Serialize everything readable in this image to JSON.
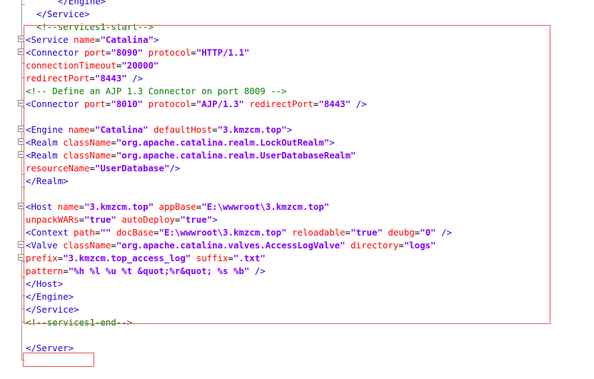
{
  "editor": {
    "lines": [
      {
        "indent": 6,
        "parts": [
          {
            "c": "tag",
            "t": "</Engine>"
          }
        ]
      },
      {
        "indent": 2,
        "parts": [
          {
            "c": "tag",
            "t": "</Service>"
          }
        ]
      },
      {
        "indent": 2,
        "parts": [
          {
            "c": "cmt",
            "t": "<!--services1-start-->"
          }
        ]
      },
      {
        "indent": 0,
        "parts": [
          {
            "c": "tag",
            "t": "<Service "
          },
          {
            "c": "attr",
            "t": "name"
          },
          {
            "c": "txt",
            "t": "="
          },
          {
            "c": "val",
            "t": "\"Catalina\""
          },
          {
            "c": "tag",
            "t": ">"
          }
        ]
      },
      {
        "indent": 0,
        "parts": [
          {
            "c": "tag",
            "t": "<Connector "
          },
          {
            "c": "attr",
            "t": "port"
          },
          {
            "c": "txt",
            "t": "="
          },
          {
            "c": "val",
            "t": "\"8090\""
          },
          {
            "c": "txt",
            "t": " "
          },
          {
            "c": "attr",
            "t": "protocol"
          },
          {
            "c": "txt",
            "t": "="
          },
          {
            "c": "val",
            "t": "\"HTTP/1.1\""
          }
        ]
      },
      {
        "indent": 0,
        "parts": [
          {
            "c": "attr",
            "t": "connectionTimeout"
          },
          {
            "c": "txt",
            "t": "="
          },
          {
            "c": "val",
            "t": "\"20000\""
          }
        ]
      },
      {
        "indent": 0,
        "parts": [
          {
            "c": "attr",
            "t": "redirectPort"
          },
          {
            "c": "txt",
            "t": "="
          },
          {
            "c": "val",
            "t": "\"8443\""
          },
          {
            "c": "txt",
            "t": " "
          },
          {
            "c": "tag",
            "t": "/>"
          }
        ]
      },
      {
        "indent": 0,
        "parts": [
          {
            "c": "cmt",
            "t": "<!-- Define an AJP 1.3 Connector on port 8009 -->"
          }
        ]
      },
      {
        "indent": 0,
        "parts": [
          {
            "c": "tag",
            "t": "<Connector "
          },
          {
            "c": "attr",
            "t": "port"
          },
          {
            "c": "txt",
            "t": "="
          },
          {
            "c": "val",
            "t": "\"8010\""
          },
          {
            "c": "txt",
            "t": " "
          },
          {
            "c": "attr",
            "t": "protocol"
          },
          {
            "c": "txt",
            "t": "="
          },
          {
            "c": "val",
            "t": "\"AJP/1.3\""
          },
          {
            "c": "txt",
            "t": " "
          },
          {
            "c": "attr",
            "t": "redirectPort"
          },
          {
            "c": "txt",
            "t": "="
          },
          {
            "c": "val",
            "t": "\"8443\""
          },
          {
            "c": "txt",
            "t": " "
          },
          {
            "c": "tag",
            "t": "/>"
          }
        ]
      },
      {
        "indent": 0,
        "parts": []
      },
      {
        "indent": 0,
        "parts": [
          {
            "c": "tag",
            "t": "<Engine "
          },
          {
            "c": "attr",
            "t": "name"
          },
          {
            "c": "txt",
            "t": "="
          },
          {
            "c": "val",
            "t": "\"Catalina\""
          },
          {
            "c": "txt",
            "t": " "
          },
          {
            "c": "attr",
            "t": "defaultHost"
          },
          {
            "c": "txt",
            "t": "="
          },
          {
            "c": "val",
            "t": "\"3.kmzcm.top\""
          },
          {
            "c": "tag",
            "t": ">"
          }
        ]
      },
      {
        "indent": 0,
        "parts": [
          {
            "c": "tag",
            "t": "<Realm "
          },
          {
            "c": "attr",
            "t": "className"
          },
          {
            "c": "txt",
            "t": "="
          },
          {
            "c": "val",
            "t": "\"org.apache.catalina.realm.LockOutRealm\""
          },
          {
            "c": "tag",
            "t": ">"
          }
        ]
      },
      {
        "indent": 0,
        "parts": [
          {
            "c": "tag",
            "t": "<Realm "
          },
          {
            "c": "attr",
            "t": "className"
          },
          {
            "c": "txt",
            "t": "="
          },
          {
            "c": "val",
            "t": "\"org.apache.catalina.realm.UserDatabaseRealm\""
          }
        ]
      },
      {
        "indent": 0,
        "parts": [
          {
            "c": "attr",
            "t": "resourceName"
          },
          {
            "c": "txt",
            "t": "="
          },
          {
            "c": "val",
            "t": "\"UserDatabase\""
          },
          {
            "c": "tag",
            "t": "/>"
          }
        ]
      },
      {
        "indent": 0,
        "parts": [
          {
            "c": "tag",
            "t": "</Realm>"
          }
        ]
      },
      {
        "indent": 0,
        "parts": []
      },
      {
        "indent": 0,
        "parts": [
          {
            "c": "tag",
            "t": "<Host "
          },
          {
            "c": "attr",
            "t": "name"
          },
          {
            "c": "txt",
            "t": "="
          },
          {
            "c": "val",
            "t": "\"3.kmzcm.top\""
          },
          {
            "c": "txt",
            "t": " "
          },
          {
            "c": "attr",
            "t": "appBase"
          },
          {
            "c": "txt",
            "t": "="
          },
          {
            "c": "val",
            "t": "\"E:\\wwwroot\\3.kmzcm.top\""
          }
        ]
      },
      {
        "indent": 0,
        "parts": [
          {
            "c": "attr",
            "t": "unpackWARs"
          },
          {
            "c": "txt",
            "t": "="
          },
          {
            "c": "val",
            "t": "\"true\""
          },
          {
            "c": "txt",
            "t": " "
          },
          {
            "c": "attr",
            "t": "autoDeploy"
          },
          {
            "c": "txt",
            "t": "="
          },
          {
            "c": "val",
            "t": "\"true\""
          },
          {
            "c": "tag",
            "t": ">"
          }
        ]
      },
      {
        "indent": 0,
        "parts": [
          {
            "c": "tag",
            "t": "<Context "
          },
          {
            "c": "attr",
            "t": "path"
          },
          {
            "c": "txt",
            "t": "="
          },
          {
            "c": "val",
            "t": "\"\""
          },
          {
            "c": "txt",
            "t": " "
          },
          {
            "c": "attr",
            "t": "docBase"
          },
          {
            "c": "txt",
            "t": "="
          },
          {
            "c": "val",
            "t": "\"E:\\wwwroot\\3.kmzcm.top\""
          },
          {
            "c": "txt",
            "t": " "
          },
          {
            "c": "attr",
            "t": "reloadable"
          },
          {
            "c": "txt",
            "t": "="
          },
          {
            "c": "val",
            "t": "\"true\""
          },
          {
            "c": "txt",
            "t": " "
          },
          {
            "c": "attr",
            "t": "deubg"
          },
          {
            "c": "txt",
            "t": "="
          },
          {
            "c": "val",
            "t": "\"0\""
          },
          {
            "c": "txt",
            "t": " "
          },
          {
            "c": "tag",
            "t": "/>"
          }
        ]
      },
      {
        "indent": 0,
        "parts": [
          {
            "c": "tag",
            "t": "<Valve "
          },
          {
            "c": "attr",
            "t": "className"
          },
          {
            "c": "txt",
            "t": "="
          },
          {
            "c": "val",
            "t": "\"org.apache.catalina.valves.AccessLogValve\""
          },
          {
            "c": "txt",
            "t": " "
          },
          {
            "c": "attr",
            "t": "directory"
          },
          {
            "c": "txt",
            "t": "="
          },
          {
            "c": "val",
            "t": "\"logs\""
          }
        ]
      },
      {
        "indent": 0,
        "parts": [
          {
            "c": "attr",
            "t": "prefix"
          },
          {
            "c": "txt",
            "t": "="
          },
          {
            "c": "val",
            "t": "\"3.kmzcm.top_access_log\""
          },
          {
            "c": "txt",
            "t": " "
          },
          {
            "c": "attr",
            "t": "suffix"
          },
          {
            "c": "txt",
            "t": "="
          },
          {
            "c": "val",
            "t": "\".txt\""
          }
        ]
      },
      {
        "indent": 0,
        "parts": [
          {
            "c": "attr",
            "t": "pattern"
          },
          {
            "c": "txt",
            "t": "="
          },
          {
            "c": "val",
            "t": "\"%h %l %u %t &quot;%r&quot; %s %b\""
          },
          {
            "c": "txt",
            "t": " "
          },
          {
            "c": "tag",
            "t": "/>"
          }
        ]
      },
      {
        "indent": 0,
        "parts": [
          {
            "c": "tag",
            "t": "</Host>"
          }
        ]
      },
      {
        "indent": 0,
        "parts": [
          {
            "c": "tag",
            "t": "</Engine>"
          }
        ]
      },
      {
        "indent": 0,
        "parts": [
          {
            "c": "tag",
            "t": "</Service>"
          }
        ]
      },
      {
        "indent": 0,
        "parts": [
          {
            "c": "cmt",
            "t": "<!--services1-end-->"
          }
        ]
      },
      {
        "indent": 0,
        "parts": []
      },
      {
        "indent": 0,
        "parts": [
          {
            "c": "tag",
            "t": "</Server>"
          }
        ]
      }
    ]
  }
}
